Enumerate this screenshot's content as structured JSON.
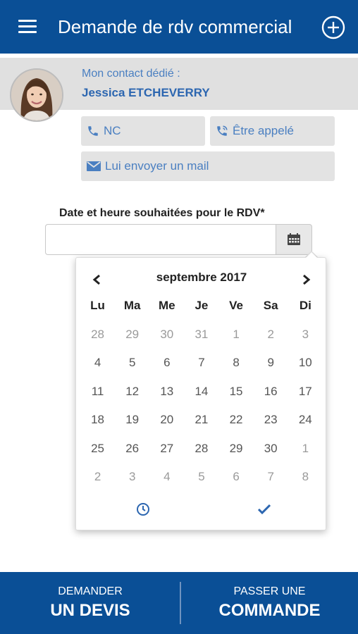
{
  "header": {
    "title": "Demande de rdv commercial",
    "background": "#0a4f96"
  },
  "contact": {
    "label": "Mon contact dédié :",
    "name": "Jessica ETCHEVERRY"
  },
  "actions": {
    "phone": "NC",
    "callback": "Être appelé",
    "mail": "Lui envoyer un mail"
  },
  "date_field": {
    "label": "Date et heure souhaitées pour le RDV*",
    "value": ""
  },
  "calendar": {
    "month": "septembre 2017",
    "weekdays": [
      "Lu",
      "Ma",
      "Me",
      "Je",
      "Ve",
      "Sa",
      "Di"
    ],
    "weeks": [
      [
        "28",
        "29",
        "30",
        "31",
        "1",
        "2",
        "3"
      ],
      [
        "4",
        "5",
        "6",
        "7",
        "8",
        "9",
        "10"
      ],
      [
        "11",
        "12",
        "13",
        "14",
        "15",
        "16",
        "17"
      ],
      [
        "18",
        "19",
        "20",
        "21",
        "22",
        "23",
        "24"
      ],
      [
        "25",
        "26",
        "27",
        "28",
        "29",
        "30",
        "1"
      ],
      [
        "2",
        "3",
        "4",
        "5",
        "6",
        "7",
        "8"
      ]
    ]
  },
  "footer": {
    "devis_small": "DEMANDER",
    "devis_big": "UN DEVIS",
    "commande_small": "PASSER UNE",
    "commande_big": "COMMANDE"
  }
}
